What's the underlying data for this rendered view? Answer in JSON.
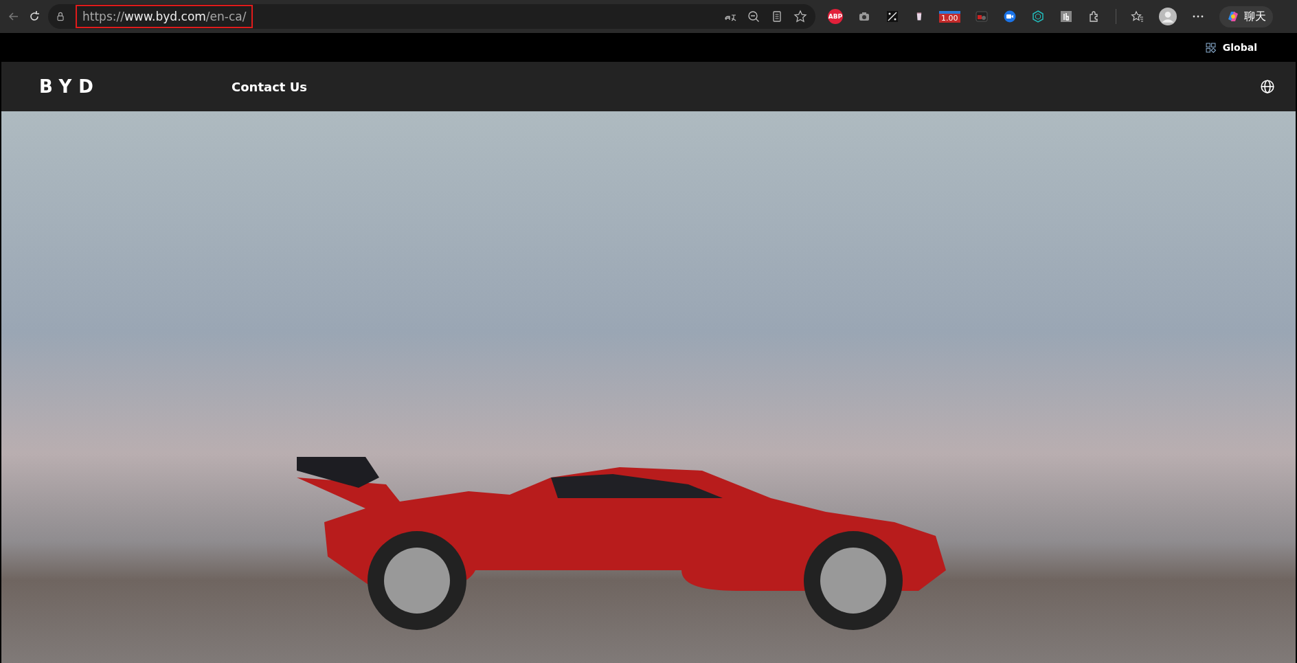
{
  "browser": {
    "url_host_prefix": "https://",
    "url_host": "www.byd.com",
    "url_path": "/en-ca/",
    "url_highlighted": true,
    "extensions": [
      {
        "kind": "abp",
        "label": "ABP"
      },
      {
        "kind": "camera"
      },
      {
        "kind": "translate"
      },
      {
        "kind": "cup"
      },
      {
        "kind": "speed",
        "label": "1.00"
      },
      {
        "kind": "record"
      },
      {
        "kind": "video"
      },
      {
        "kind": "hex"
      },
      {
        "kind": "tb"
      }
    ],
    "chat_label": "聊天"
  },
  "top_strip": {
    "region_label": "Global"
  },
  "nav": {
    "logo": "BYD",
    "links": [
      "Contact Us"
    ]
  }
}
